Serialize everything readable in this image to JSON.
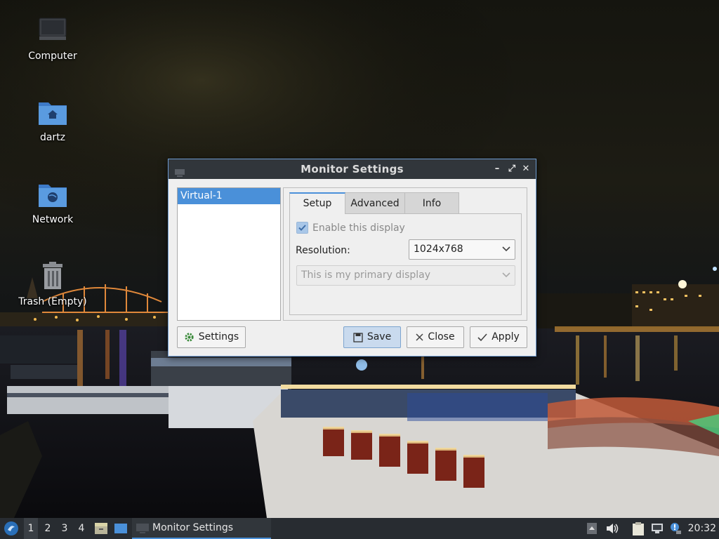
{
  "desktop": {
    "icons": [
      {
        "label": "Computer",
        "icon": "computer-icon"
      },
      {
        "label": "dartz",
        "icon": "home-folder-icon"
      },
      {
        "label": "Network",
        "icon": "network-folder-icon"
      },
      {
        "label": "Trash (Empty)",
        "icon": "trash-icon"
      }
    ]
  },
  "window": {
    "title": "Monitor Settings",
    "controls": {
      "minimize": "–",
      "maximize": "⤢",
      "close": "✕"
    },
    "monitors": [
      "Virtual-1"
    ],
    "tabs": [
      "Setup",
      "Advanced",
      "Info"
    ],
    "active_tab": "Setup",
    "setup": {
      "enable_label": "Enable this display",
      "enabled": true,
      "resolution_label": "Resolution:",
      "resolution_value": "1024x768",
      "primary_value": "This is my primary display"
    },
    "buttons": {
      "settings": "Settings",
      "save": "Save",
      "close": "Close",
      "apply": "Apply"
    }
  },
  "taskbar": {
    "workspaces": [
      "1",
      "2",
      "3",
      "4"
    ],
    "active_workspace": "1",
    "task_title": "Monitor Settings",
    "clock": "20:32"
  },
  "colors": {
    "accent": "#4a90d9",
    "titlebar": "#31363b",
    "taskbar": "#282c31"
  }
}
